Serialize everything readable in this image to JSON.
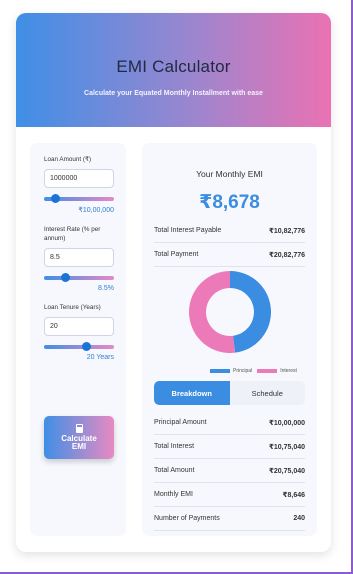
{
  "header": {
    "title": "EMI Calculator",
    "subtitle": "Calculate your Equated Monthly Installment with ease"
  },
  "form": {
    "loan_amount": {
      "label": "Loan Amount (₹)",
      "value": "1000000",
      "display": "₹10,00,000",
      "slider_fraction": 0.12
    },
    "interest_rate": {
      "label": "Interest Rate (% per annum)",
      "value": "8.5",
      "display": "8.5%",
      "slider_fraction": 0.28
    },
    "loan_tenure": {
      "label": "Loan Tenure (Years)",
      "value": "20",
      "display": "20 Years",
      "slider_fraction": 0.63
    },
    "calculate_button": "Calculate EMI"
  },
  "result": {
    "title": "Your Monthly EMI",
    "amount": "₹8,678",
    "summary": [
      {
        "label": "Total Interest Payable",
        "value": "₹10,82,776"
      },
      {
        "label": "Total Payment",
        "value": "₹20,82,776"
      }
    ],
    "chart_data": {
      "type": "pie",
      "categories": [
        "Principal",
        "Interest"
      ],
      "values": [
        1000000,
        1082776
      ],
      "colors": [
        "#3a8de0",
        "#ec7ab8"
      ],
      "legend_position": "bottom"
    },
    "tabs": [
      {
        "label": "Breakdown",
        "active": true
      },
      {
        "label": "Schedule",
        "active": false
      }
    ],
    "breakdown": [
      {
        "label": "Principal Amount",
        "value": "₹10,00,000"
      },
      {
        "label": "Total Interest",
        "value": "₹10,75,040"
      },
      {
        "label": "Total Amount",
        "value": "₹20,75,040"
      },
      {
        "label": "Monthly EMI",
        "value": "₹8,646"
      },
      {
        "label": "Number of Payments",
        "value": "240"
      }
    ]
  }
}
